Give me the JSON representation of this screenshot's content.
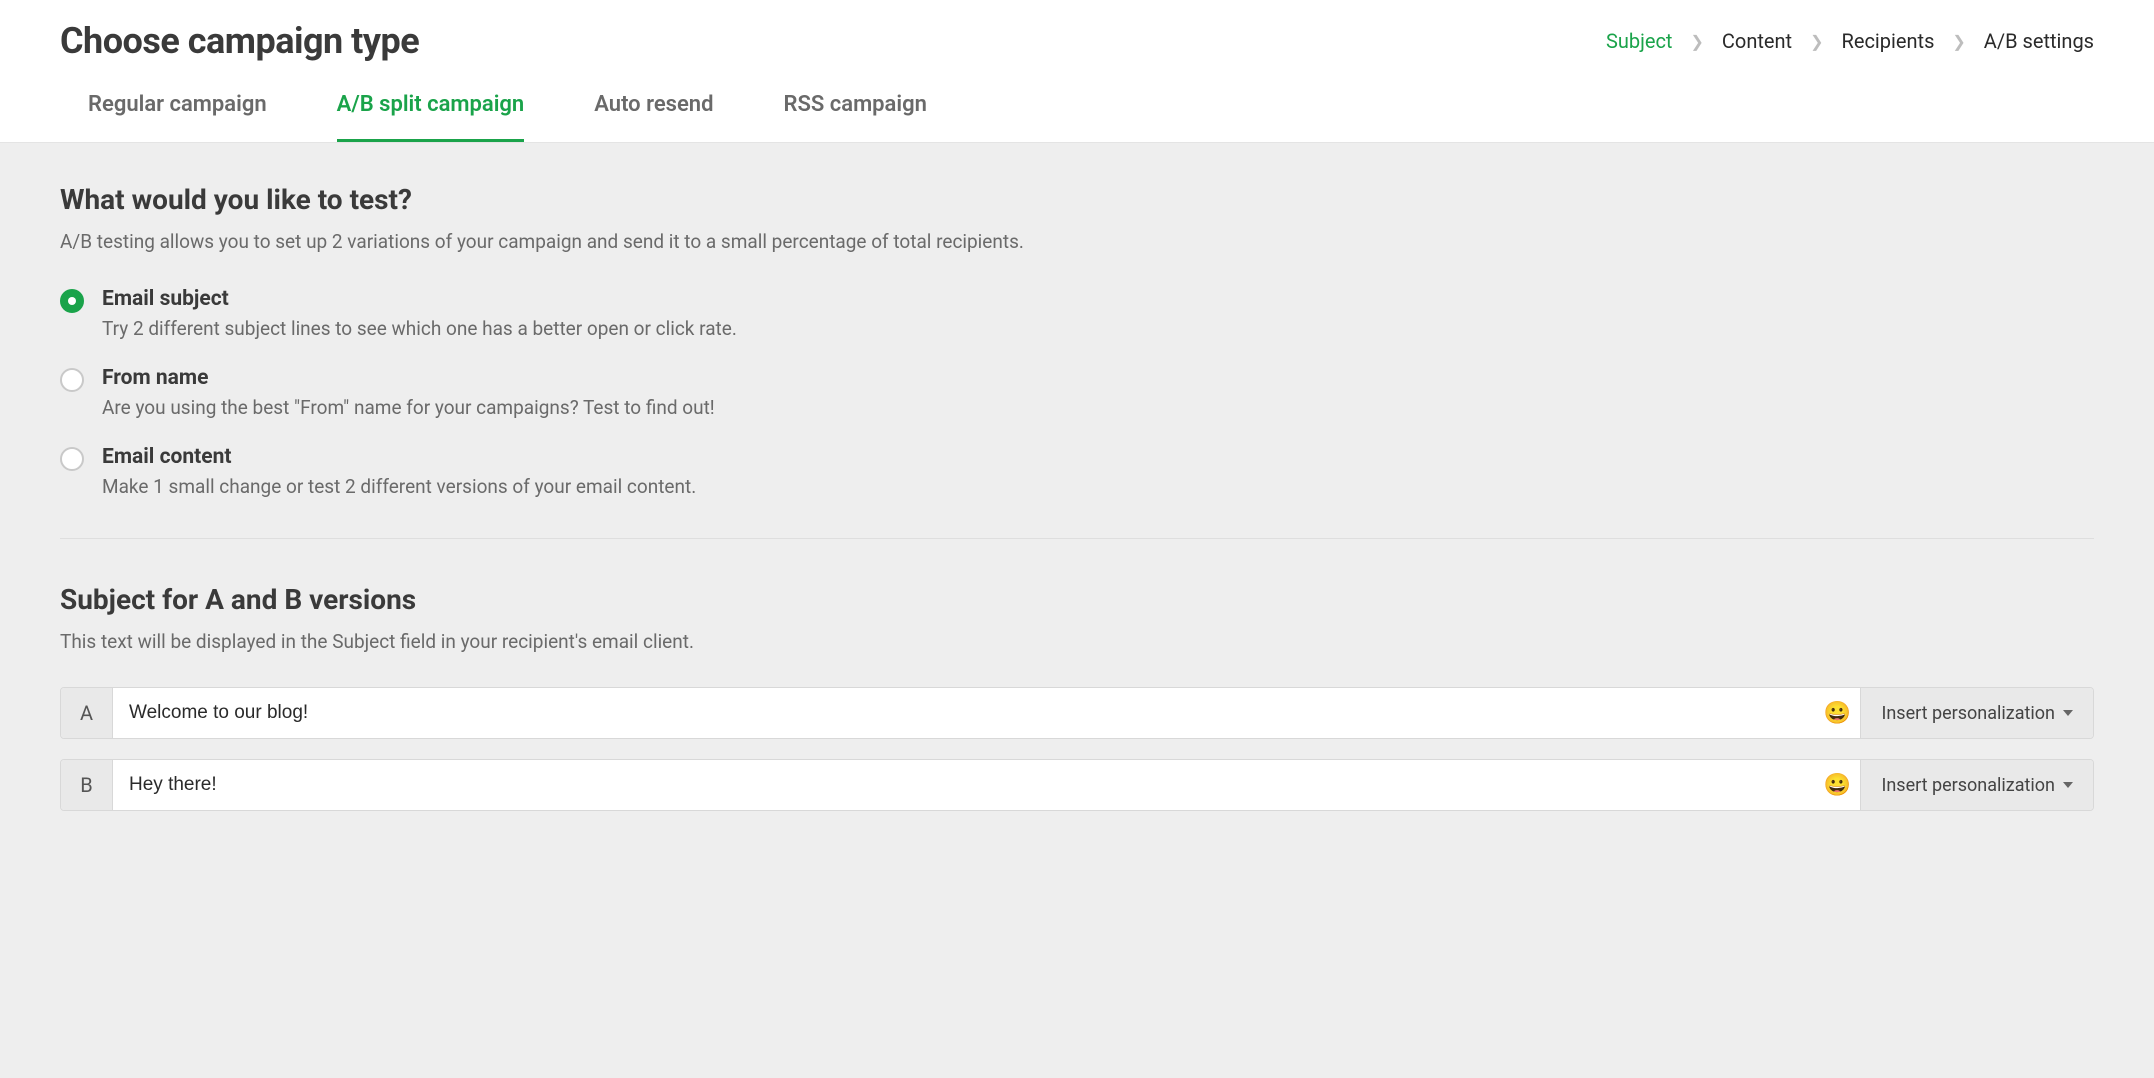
{
  "page_title": "Choose campaign type",
  "breadcrumb": [
    {
      "label": "Subject",
      "active": true
    },
    {
      "label": "Content",
      "active": false
    },
    {
      "label": "Recipients",
      "active": false
    },
    {
      "label": "A/B settings",
      "active": false
    }
  ],
  "tabs": [
    {
      "label": "Regular campaign",
      "active": false
    },
    {
      "label": "A/B split campaign",
      "active": true
    },
    {
      "label": "Auto resend",
      "active": false
    },
    {
      "label": "RSS campaign",
      "active": false
    }
  ],
  "test_section": {
    "title": "What would you like to test?",
    "desc": "A/B testing allows you to set up 2 variations of your campaign and send it to a small percentage of total recipients.",
    "options": [
      {
        "title": "Email subject",
        "desc": "Try 2 different subject lines to see which one has a better open or click rate.",
        "selected": true
      },
      {
        "title": "From name",
        "desc": "Are you using the best \"From\" name for your campaigns? Test to find out!",
        "selected": false
      },
      {
        "title": "Email content",
        "desc": "Make 1 small change or test 2 different versions of your email content.",
        "selected": false
      }
    ]
  },
  "subject_section": {
    "title": "Subject for A and B versions",
    "desc": "This text will be displayed in the Subject field in your recipient's email client.",
    "personalization_label": "Insert personalization",
    "emoji": "😀",
    "versions": [
      {
        "prefix": "A",
        "value": "Welcome to our blog!"
      },
      {
        "prefix": "B",
        "value": "Hey there!"
      }
    ]
  }
}
